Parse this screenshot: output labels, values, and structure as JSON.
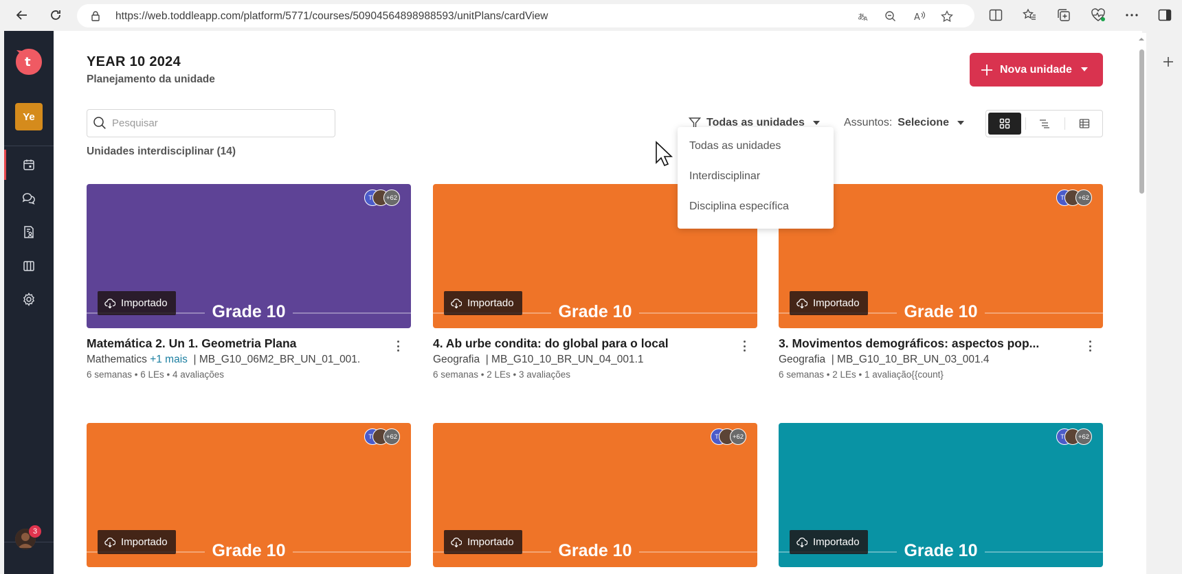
{
  "browser": {
    "url": "https://web.toddleapp.com/platform/5771/courses/50904564898988593/unitPlans/cardView"
  },
  "sidebar": {
    "workspace_badge": "Ye",
    "notification_count": "3"
  },
  "header": {
    "title": "YEAR 10 2024",
    "subtitle": "Planejamento da unidade",
    "new_unit_label": "Nova unidade"
  },
  "toolbar": {
    "search_placeholder": "Pesquisar",
    "filter_label": "Todas as unidades",
    "subjects_label": "Assuntos:",
    "subjects_value": "Selecione"
  },
  "filter_dropdown": {
    "options": [
      "Todas as unidades",
      "Interdisciplinar",
      "Disciplina específica"
    ]
  },
  "section": {
    "title": "Unidades interdisciplinar (14)"
  },
  "colors": {
    "brand": "#d9334f",
    "purple": "#5e4396",
    "orange": "#ef7428",
    "teal": "#0993a4"
  },
  "cards": [
    {
      "tag": "Importado",
      "grade": "Grade 10",
      "avatar_more": "+62",
      "avatar_initials": "TS",
      "title": "Matemática 2. Un 1. Geometria Plana",
      "subject": "Mathematics",
      "more": "+1 mais",
      "code": "| MB_G10_06M2_BR_UN_01_001.",
      "meta": "6 semanas • 6 LEs • 4 avaliações"
    },
    {
      "tag": "Importado",
      "grade": "Grade 10",
      "avatar_more": "+62",
      "avatar_initials": "TS",
      "title": "4. Ab urbe condita: do global para o local",
      "subject": "Geografia",
      "code": "| MB_G10_10_BR_UN_04_001.1",
      "meta": "6 semanas • 2 LEs • 3 avaliações"
    },
    {
      "tag": "Importado",
      "grade": "Grade 10",
      "avatar_more": "+62",
      "avatar_initials": "TS",
      "title": "3. Movimentos demográficos: aspectos pop...",
      "subject": "Geografia",
      "code": "| MB_G10_10_BR_UN_03_001.4",
      "meta": "6 semanas • 2 LEs • 1 avaliação{{count}"
    },
    {
      "tag": "Importado",
      "grade": "Grade 10",
      "avatar_more": "+62",
      "avatar_initials": "TS"
    },
    {
      "tag": "Importado",
      "grade": "Grade 10",
      "avatar_more": "+62",
      "avatar_initials": "TS"
    },
    {
      "tag": "Importado",
      "grade": "Grade 10",
      "avatar_more": "+62",
      "avatar_initials": "TS"
    }
  ]
}
